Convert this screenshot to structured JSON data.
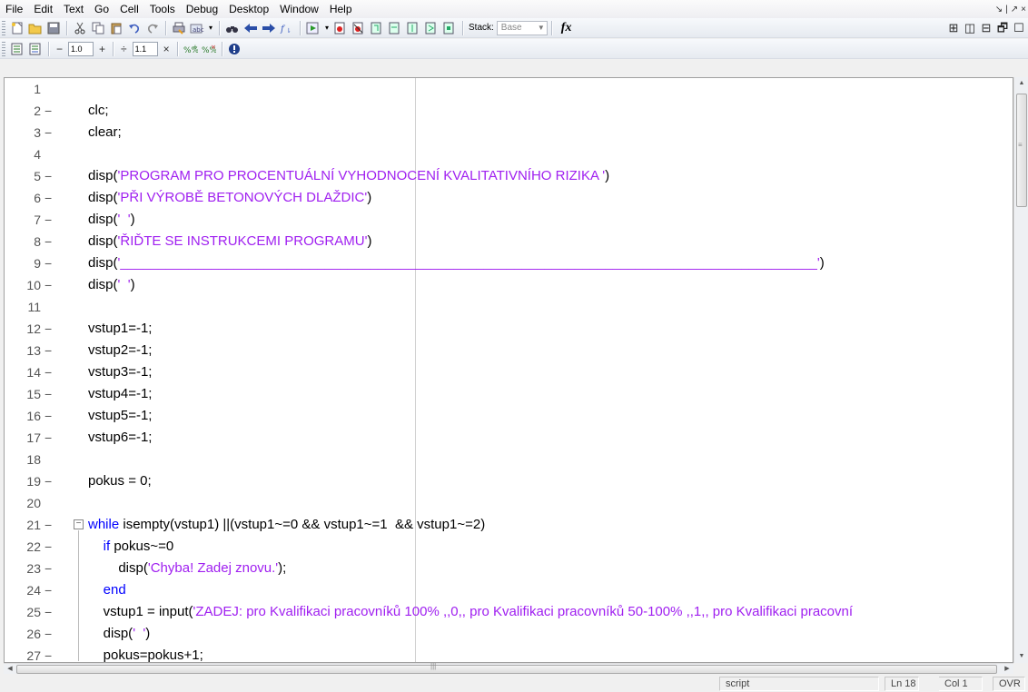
{
  "menubar": {
    "items": [
      "File",
      "Edit",
      "Text",
      "Go",
      "Cell",
      "Tools",
      "Debug",
      "Desktop",
      "Window",
      "Help"
    ],
    "right_glyphs": [
      "↘",
      "|",
      "↗",
      "×"
    ]
  },
  "toolbar": {
    "stack_label": "Stack:",
    "stack_value": "Base",
    "fx": "fx"
  },
  "cell_toolbar": {
    "minus": "−",
    "value1": "1.0",
    "plus": "+",
    "divide": "÷",
    "value2": "1.1",
    "times": "×"
  },
  "editor": {
    "lines": [
      {
        "n": "1",
        "dash": "",
        "code": []
      },
      {
        "n": "2",
        "dash": "−",
        "code": [
          {
            "t": "clc;",
            "c": ""
          }
        ]
      },
      {
        "n": "3",
        "dash": "−",
        "code": [
          {
            "t": "clear;",
            "c": ""
          }
        ]
      },
      {
        "n": "4",
        "dash": "",
        "code": []
      },
      {
        "n": "5",
        "dash": "−",
        "code": [
          {
            "t": "disp(",
            "c": ""
          },
          {
            "t": "'PROGRAM PRO PROCENTUÁLNÍ VYHODNOCENÍ KVALITATIVNÍHO RIZIKA '",
            "c": "str"
          },
          {
            "t": ")",
            "c": ""
          }
        ]
      },
      {
        "n": "6",
        "dash": "−",
        "code": [
          {
            "t": "disp(",
            "c": ""
          },
          {
            "t": "'PŘI VÝROBĚ BETONOVÝCH DLAŽDIC'",
            "c": "str"
          },
          {
            "t": ")",
            "c": ""
          }
        ]
      },
      {
        "n": "7",
        "dash": "−",
        "code": [
          {
            "t": "disp(",
            "c": ""
          },
          {
            "t": "'  '",
            "c": "str"
          },
          {
            "t": ")",
            "c": ""
          }
        ]
      },
      {
        "n": "8",
        "dash": "−",
        "code": [
          {
            "t": "disp(",
            "c": ""
          },
          {
            "t": "'ŘIĎTE SE INSTRUKCEMI PROGRAMU'",
            "c": "str"
          },
          {
            "t": ")",
            "c": ""
          }
        ]
      },
      {
        "n": "9",
        "dash": "−",
        "code": [
          {
            "t": "disp(",
            "c": ""
          },
          {
            "t": "'____________________________________________________________________________________________'",
            "c": "str"
          },
          {
            "t": ")",
            "c": ""
          }
        ]
      },
      {
        "n": "10",
        "dash": "−",
        "code": [
          {
            "t": "disp(",
            "c": ""
          },
          {
            "t": "'  '",
            "c": "str"
          },
          {
            "t": ")",
            "c": ""
          }
        ]
      },
      {
        "n": "11",
        "dash": "",
        "code": []
      },
      {
        "n": "12",
        "dash": "−",
        "code": [
          {
            "t": "vstup1=-1;",
            "c": ""
          }
        ]
      },
      {
        "n": "13",
        "dash": "−",
        "code": [
          {
            "t": "vstup2=-1;",
            "c": ""
          }
        ]
      },
      {
        "n": "14",
        "dash": "−",
        "code": [
          {
            "t": "vstup3=-1;",
            "c": ""
          }
        ]
      },
      {
        "n": "15",
        "dash": "−",
        "code": [
          {
            "t": "vstup4=-1;",
            "c": ""
          }
        ]
      },
      {
        "n": "16",
        "dash": "−",
        "code": [
          {
            "t": "vstup5=-1;",
            "c": ""
          }
        ]
      },
      {
        "n": "17",
        "dash": "−",
        "code": [
          {
            "t": "vstup6=-1;",
            "c": ""
          }
        ]
      },
      {
        "n": "18",
        "dash": "",
        "code": []
      },
      {
        "n": "19",
        "dash": "−",
        "code": [
          {
            "t": "pokus = 0;",
            "c": ""
          }
        ]
      },
      {
        "n": "20",
        "dash": "",
        "code": []
      },
      {
        "n": "21",
        "dash": "−",
        "code": [
          {
            "t": "while",
            "c": "kw"
          },
          {
            "t": " isempty(vstup1) ||(vstup1~=0 && vstup1~=1  && vstup1~=2)",
            "c": ""
          }
        ]
      },
      {
        "n": "22",
        "dash": "−",
        "code": [
          {
            "t": "    ",
            "c": ""
          },
          {
            "t": "if",
            "c": "kw"
          },
          {
            "t": " pokus~=0",
            "c": ""
          }
        ]
      },
      {
        "n": "23",
        "dash": "−",
        "code": [
          {
            "t": "        disp(",
            "c": ""
          },
          {
            "t": "'Chyba! Zadej znovu.'",
            "c": "str"
          },
          {
            "t": ");",
            "c": ""
          }
        ]
      },
      {
        "n": "24",
        "dash": "−",
        "code": [
          {
            "t": "    ",
            "c": ""
          },
          {
            "t": "end",
            "c": "kw"
          }
        ]
      },
      {
        "n": "25",
        "dash": "−",
        "code": [
          {
            "t": "    vstup1 = input(",
            "c": ""
          },
          {
            "t": "'ZADEJ: pro Kvalifikaci pracovníků 100% ,,0,, pro Kvalifikaci pracovníků 50-100% ,,1,, pro Kvalifikaci pracovní",
            "c": "str"
          }
        ]
      },
      {
        "n": "26",
        "dash": "−",
        "code": [
          {
            "t": "    disp(",
            "c": ""
          },
          {
            "t": "'  '",
            "c": "str"
          },
          {
            "t": ")",
            "c": ""
          }
        ]
      },
      {
        "n": "27",
        "dash": "−",
        "code": [
          {
            "t": "    pokus=pokus+1;",
            "c": ""
          }
        ]
      }
    ]
  },
  "scroll": {
    "grip": "|||",
    "grip_v": "≡"
  },
  "statusbar": {
    "mode": "script",
    "ln": "Ln  18",
    "col": "Col  1",
    "ovr": "OVR"
  }
}
